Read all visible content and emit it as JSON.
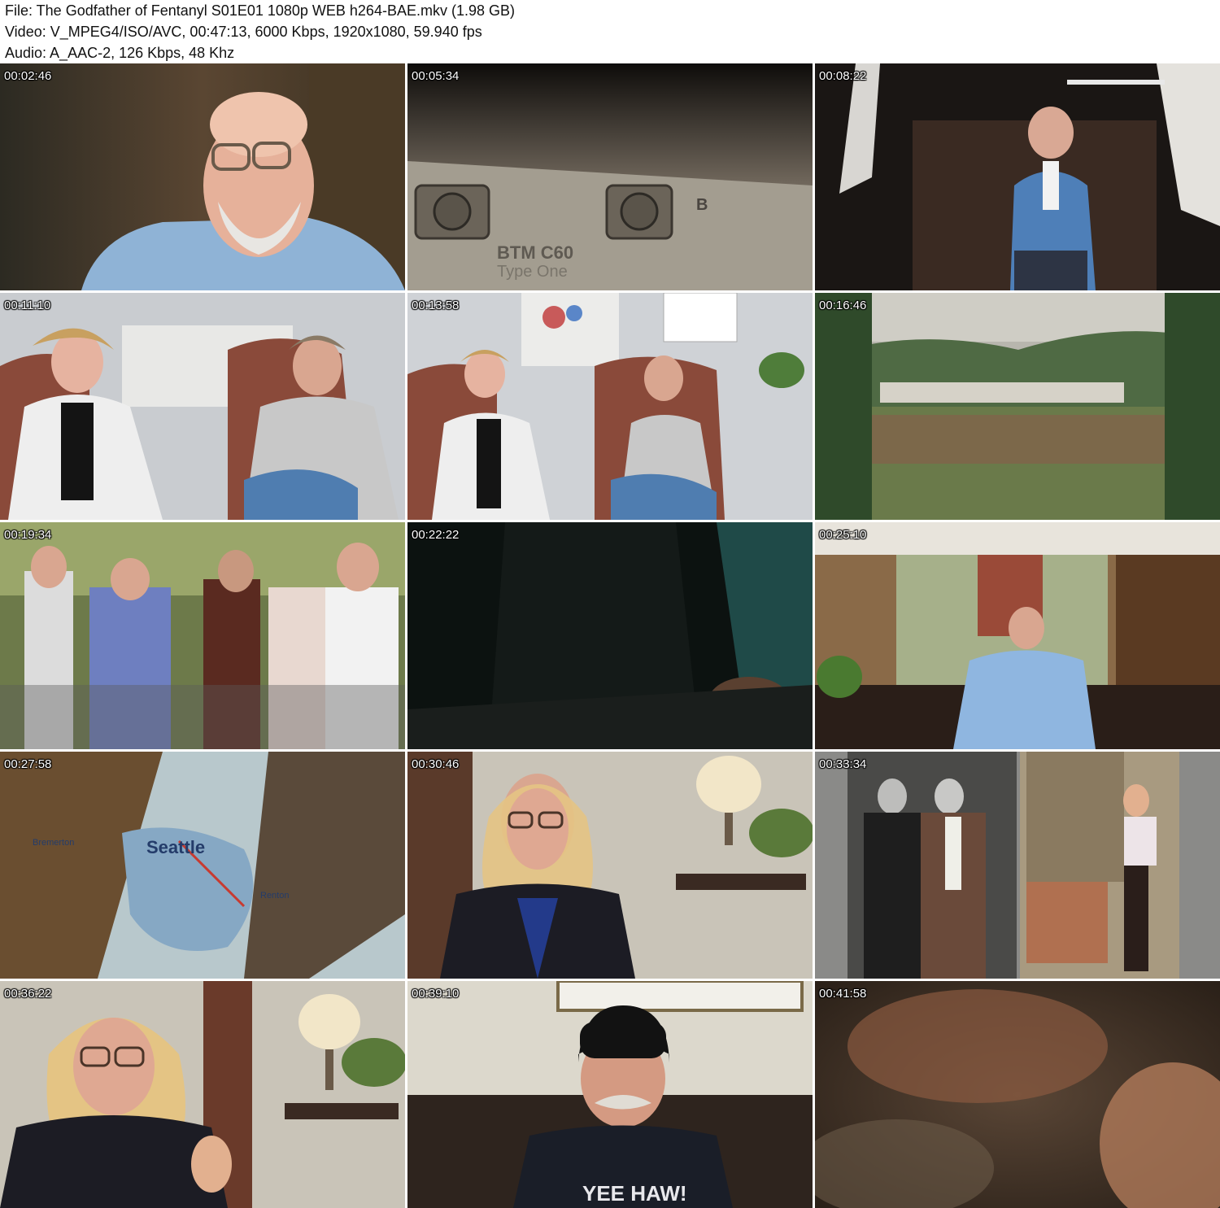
{
  "header": {
    "file_line": "File: The Godfather of Fentanyl S01E01 1080p WEB h264-BAE.mkv (1.98 GB)",
    "video_line": "Video: V_MPEG4/ISO/AVC, 00:47:13, 6000 Kbps, 1920x1080, 59.940 fps",
    "audio_line": "Audio: A_AAC-2, 126 Kbps, 48 Khz"
  },
  "thumbnails": [
    {
      "timestamp": "00:02:46",
      "scene": "bald-man-glasses-beard"
    },
    {
      "timestamp": "00:05:34",
      "scene": "cassette-tape",
      "caption_text": "BTM C60",
      "caption_sub": "Type One",
      "side_label": "B"
    },
    {
      "timestamp": "00:08:22",
      "scene": "man-blue-suit-studio"
    },
    {
      "timestamp": "00:11:10",
      "scene": "two-women-armchairs-close"
    },
    {
      "timestamp": "00:13:58",
      "scene": "two-women-armchairs-wide"
    },
    {
      "timestamp": "00:16:46",
      "scene": "festival-crowd-field"
    },
    {
      "timestamp": "00:19:34",
      "scene": "crowd-walking-archival"
    },
    {
      "timestamp": "00:22:22",
      "scene": "dark-hand-writing"
    },
    {
      "timestamp": "00:25:10",
      "scene": "man-seated-sunroom"
    },
    {
      "timestamp": "00:27:58",
      "scene": "map-seattle",
      "map_labels": [
        "Seattle",
        "Bremerton",
        "Renton"
      ]
    },
    {
      "timestamp": "00:30:46",
      "scene": "woman-glasses-interview"
    },
    {
      "timestamp": "00:33:34",
      "scene": "archival-photos-two"
    },
    {
      "timestamp": "00:36:22",
      "scene": "woman-glasses-gesturing"
    },
    {
      "timestamp": "00:39:10",
      "scene": "man-black-beanie",
      "shirt_text": "YEE HAW!"
    },
    {
      "timestamp": "00:41:58",
      "scene": "blurred-hands-closeup"
    }
  ],
  "colors": {
    "background": "#ffffff",
    "header_text": "#111111",
    "timestamp_text": "#ffffff"
  }
}
